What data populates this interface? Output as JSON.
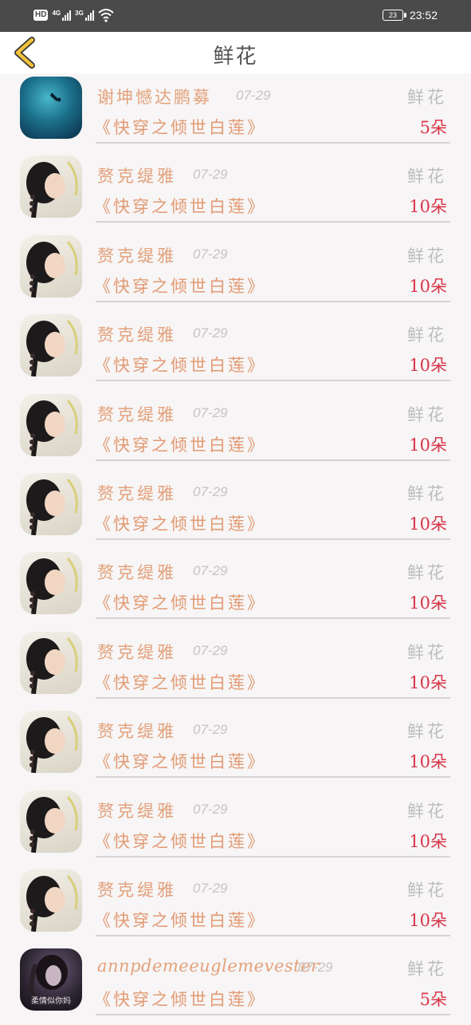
{
  "status_bar": {
    "hd": "HD",
    "sim1_network": "4G",
    "sim2_network": "3G",
    "battery": "23",
    "time": "23:52"
  },
  "header": {
    "title": "鲜花"
  },
  "rows": [
    {
      "name": "谢坤憾达鹏募",
      "date": "07-29",
      "book": "《快穿之倾世白莲》",
      "gift_label": "鲜花",
      "gift_count": "5朵",
      "avatar": "underwater"
    },
    {
      "name": "赘克缇雅",
      "date": "07-29",
      "book": "《快穿之倾世白莲》",
      "gift_label": "鲜花",
      "gift_count": "10朵",
      "avatar": "portrait"
    },
    {
      "name": "赘克缇雅",
      "date": "07-29",
      "book": "《快穿之倾世白莲》",
      "gift_label": "鲜花",
      "gift_count": "10朵",
      "avatar": "portrait"
    },
    {
      "name": "赘克缇雅",
      "date": "07-29",
      "book": "《快穿之倾世白莲》",
      "gift_label": "鲜花",
      "gift_count": "10朵",
      "avatar": "portrait"
    },
    {
      "name": "赘克缇雅",
      "date": "07-29",
      "book": "《快穿之倾世白莲》",
      "gift_label": "鲜花",
      "gift_count": "10朵",
      "avatar": "portrait"
    },
    {
      "name": "赘克缇雅",
      "date": "07-29",
      "book": "《快穿之倾世白莲》",
      "gift_label": "鲜花",
      "gift_count": "10朵",
      "avatar": "portrait"
    },
    {
      "name": "赘克缇雅",
      "date": "07-29",
      "book": "《快穿之倾世白莲》",
      "gift_label": "鲜花",
      "gift_count": "10朵",
      "avatar": "portrait"
    },
    {
      "name": "赘克缇雅",
      "date": "07-29",
      "book": "《快穿之倾世白莲》",
      "gift_label": "鲜花",
      "gift_count": "10朵",
      "avatar": "portrait"
    },
    {
      "name": "赘克缇雅",
      "date": "07-29",
      "book": "《快穿之倾世白莲》",
      "gift_label": "鲜花",
      "gift_count": "10朵",
      "avatar": "portrait"
    },
    {
      "name": "赘克缇雅",
      "date": "07-29",
      "book": "《快穿之倾世白莲》",
      "gift_label": "鲜花",
      "gift_count": "10朵",
      "avatar": "portrait"
    },
    {
      "name": "赘克缇雅",
      "date": "07-29",
      "book": "《快穿之倾世白莲》",
      "gift_label": "鲜花",
      "gift_count": "10朵",
      "avatar": "portrait"
    },
    {
      "name": "annpdemeeuglemevester",
      "date": "07-29",
      "book": "《快穿之倾世白莲》",
      "gift_label": "鲜花",
      "gift_count": "5朵",
      "avatar": "dark-portrait",
      "avatar_caption": "柔情似你妈"
    }
  ],
  "colors": {
    "name": "#e3a17c",
    "book": "#e29a74",
    "count": "#d9364a",
    "back_arrow": "#f2c23a"
  },
  "icons": [
    "back-arrow-icon",
    "wifi-icon",
    "signal-icon",
    "battery-icon"
  ]
}
